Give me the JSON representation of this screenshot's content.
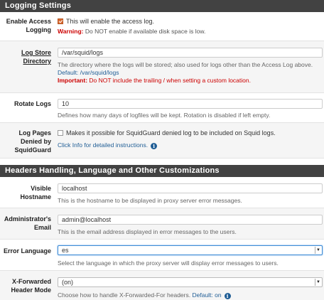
{
  "logging": {
    "heading": "Logging Settings",
    "access": {
      "label": "Enable Access Logging",
      "checked": true,
      "text": "This will enable the access log.",
      "warning_label": "Warning:",
      "warning_text": "Do NOT enable if available disk space is low."
    },
    "store": {
      "label": "Log Store Directory",
      "value": "/var/squid/logs",
      "help": "The directory where the logs will be stored; also used for logs other than the Access Log above.",
      "default": "Default: /var/squid/logs",
      "important_label": "Important:",
      "important_text": "Do NOT include the trailing / when setting a custom location."
    },
    "rotate": {
      "label": "Rotate Logs",
      "value": "10",
      "help": "Defines how many days of logfiles will be kept. Rotation is disabled if left empty."
    },
    "pages": {
      "label": "Log Pages Denied by SquidGuard",
      "checked": false,
      "text": "Makes it possible for SquidGuard denied log to be included on Squid logs.",
      "info": "Click Info for detailed instructions."
    }
  },
  "headers": {
    "heading": "Headers Handling, Language and Other Customizations",
    "hostname": {
      "label": "Visible Hostname",
      "value": "localhost",
      "help": "This is the hostname to be displayed in proxy server error messages."
    },
    "email": {
      "label": "Administrator's Email",
      "value": "admin@localhost",
      "help": "This is the email address displayed in error messages to the users."
    },
    "language": {
      "label": "Error Language",
      "value": "es",
      "help": "Select the language in which the proxy server will display error messages to users."
    },
    "xff": {
      "label": "X-Forwarded Header Mode",
      "value": "(on)",
      "help": "Choose how to handle X-Forwarded-For headers.",
      "default": "Default: on"
    }
  },
  "colors": {
    "heading_bg": "#424242",
    "warning": "#cc0000",
    "link": "#1f5d95",
    "checkbox_checked": "#d86a33"
  },
  "icons": {
    "info": "info-circle-icon",
    "select_arrow": "chevron-down-icon"
  }
}
